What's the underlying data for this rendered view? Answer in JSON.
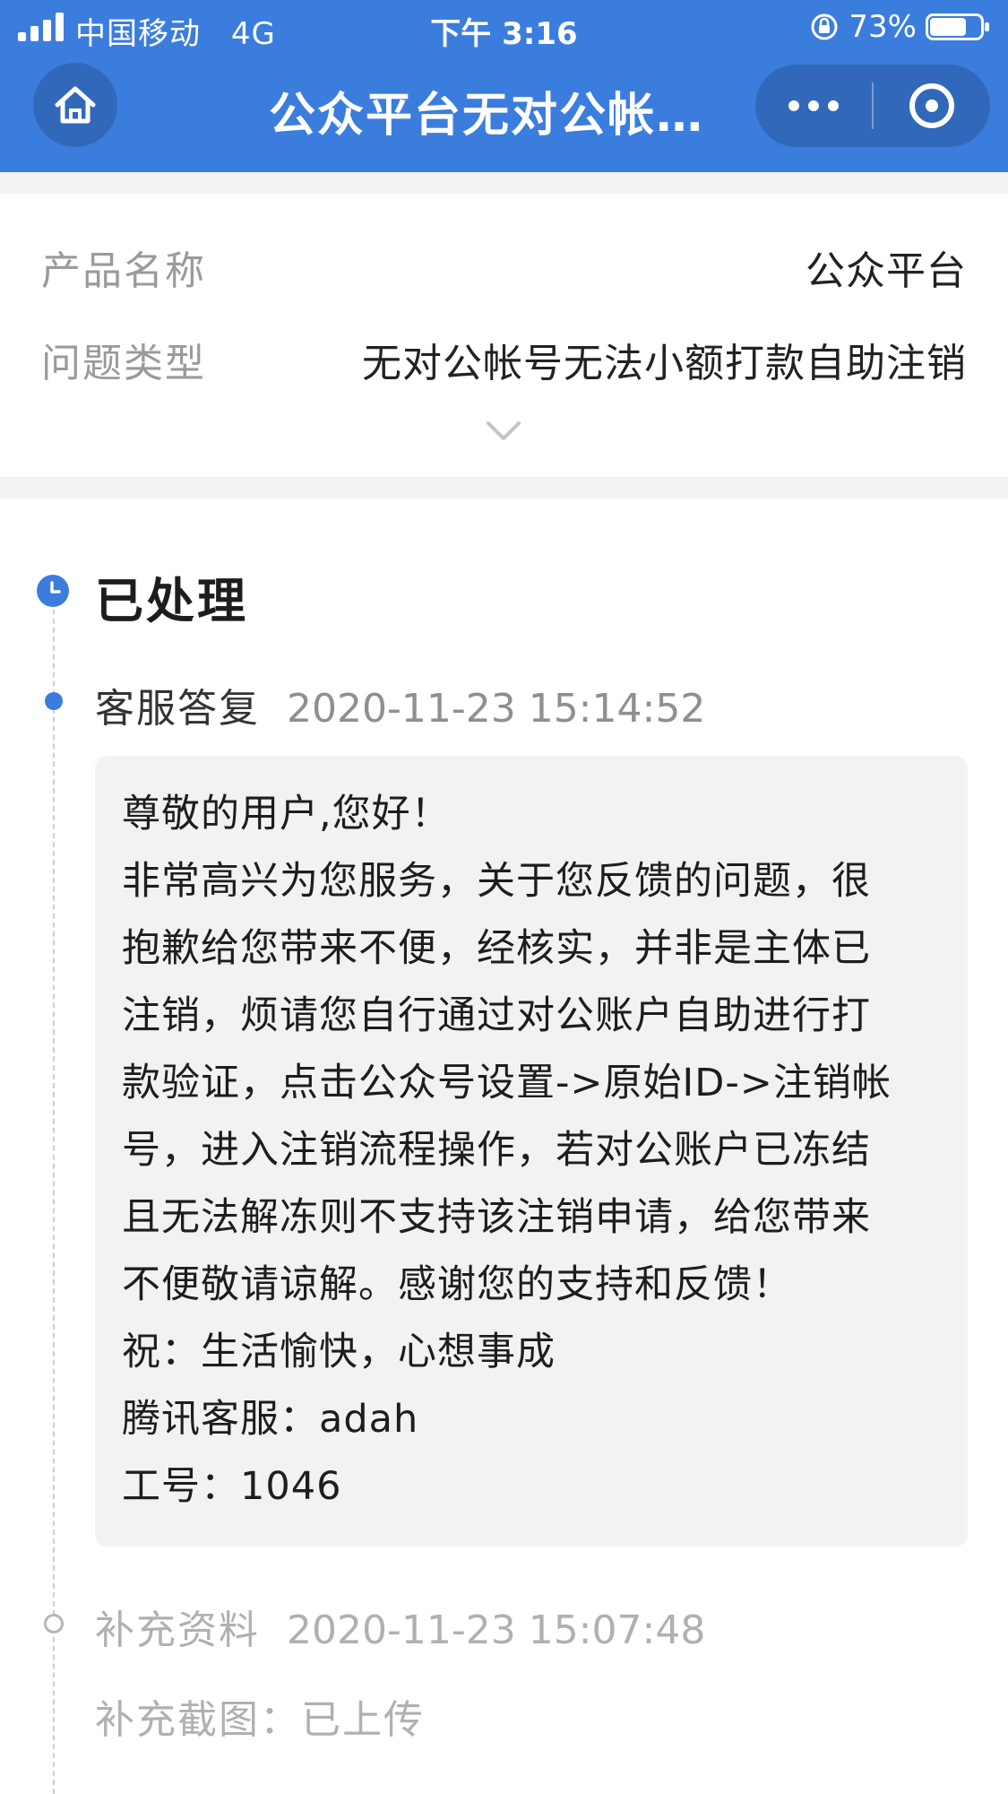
{
  "status_bar": {
    "carrier": "中国移动",
    "network": "4G",
    "time": "下午 3:16",
    "battery": "73%",
    "battery_level": 0.73
  },
  "nav": {
    "title": "公众平台无对公帐号无法小额打款自助注销",
    "home_icon": "home-icon",
    "more_icon": "more-dots-icon",
    "close_icon": "target-circle-icon"
  },
  "info": {
    "product_label": "产品名称",
    "product_value": "公众平台",
    "type_label": "问题类型",
    "type_value": "无对公帐号无法小额打款自助注销"
  },
  "timeline": {
    "status": "已处理",
    "status_color": "#3b7ddd",
    "reply": {
      "kind": "客服答复",
      "time": "2020-11-23 15:14:52",
      "lines": [
        "尊敬的用户,您好！",
        "非常高兴为您服务，关于您反馈的问题，很",
        "抱歉给您带来不便，经核实，并非是主体已",
        "注销，烦请您自行通过对公账户自助进行打",
        "款验证，点击公众号设置->原始ID->注销帐",
        "号，进入注销流程操作，若对公账户已冻结",
        "且无法解冻则不支持该注销申请，给您带来",
        "不便敬请谅解。感谢您的支持和反馈！",
        "祝：生活愉快，心想事成",
        "腾讯客服：adah",
        "工号：1046"
      ]
    },
    "supplement": {
      "kind": "补充资料",
      "time": "2020-11-23 15:07:48",
      "screenshot_text": "补充截图：已上传"
    }
  }
}
